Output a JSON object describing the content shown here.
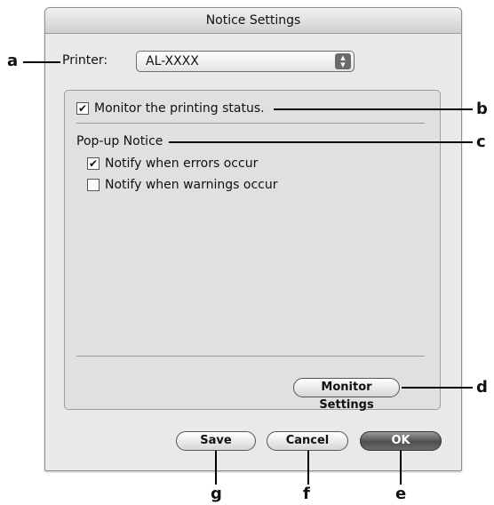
{
  "window": {
    "title": "Notice Settings"
  },
  "printer": {
    "label": "Printer:",
    "value": "AL-XXXX"
  },
  "monitor": {
    "label": "Monitor the printing status.",
    "checked": true
  },
  "popup": {
    "label": "Pop-up Notice",
    "options": [
      {
        "label": "Notify when errors occur",
        "checked": true
      },
      {
        "label": "Notify when warnings occur",
        "checked": false
      }
    ]
  },
  "buttons": {
    "monitor_settings": "Monitor Settings",
    "save": "Save",
    "cancel": "Cancel",
    "ok": "OK"
  },
  "callouts": {
    "a": "a",
    "b": "b",
    "c": "c",
    "d": "d",
    "e": "e",
    "f": "f",
    "g": "g"
  },
  "glyphs": {
    "check": "✔",
    "stepper": "▲▼"
  }
}
